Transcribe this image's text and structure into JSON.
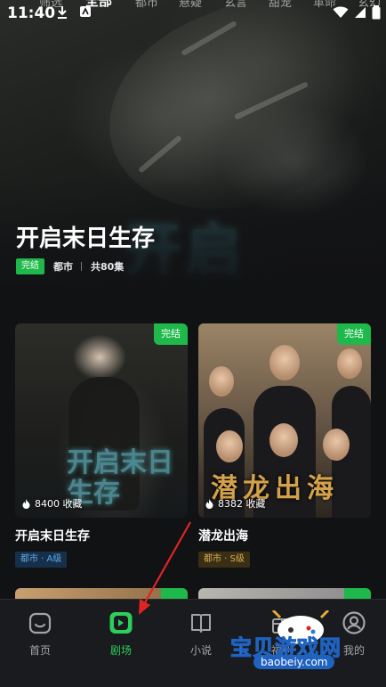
{
  "status_bar": {
    "time": "11:40"
  },
  "top_tabs": [
    "筛选",
    "全部",
    "都市",
    "悬疑",
    "玄言",
    "甜宠",
    "革命",
    "玄幻"
  ],
  "hero": {
    "title": "开启末日生存",
    "badge": "完结",
    "genre": "都市",
    "episodes": "共80集",
    "watermark_text": "开启"
  },
  "cards": [
    {
      "title": "开启末日生存",
      "badge": "完结",
      "collect_count": "8400 收藏",
      "tag": "都市 · A级",
      "poster_text": "开启末日生存"
    },
    {
      "title": "潜龙出海",
      "badge": "完结",
      "collect_count": "8382 收藏",
      "tag": "都市 · S级",
      "poster_text": "潜龙出海"
    }
  ],
  "bottom_nav": [
    {
      "label": "首页",
      "icon": "home-icon",
      "active": false
    },
    {
      "label": "剧场",
      "icon": "theater-play-icon",
      "active": true
    },
    {
      "label": "小说",
      "icon": "book-icon",
      "active": false
    },
    {
      "label": "福利",
      "icon": "gift-icon",
      "active": false
    },
    {
      "label": "我的",
      "icon": "profile-icon",
      "active": false
    }
  ],
  "overlay_watermark": {
    "text": "宝贝游戏网",
    "url_text": "baobeiy.com"
  },
  "colors": {
    "accent_green": "#1fb84a",
    "background": "#111214",
    "nav_active": "#2ccf5a",
    "annotation_arrow": "#e02424"
  }
}
